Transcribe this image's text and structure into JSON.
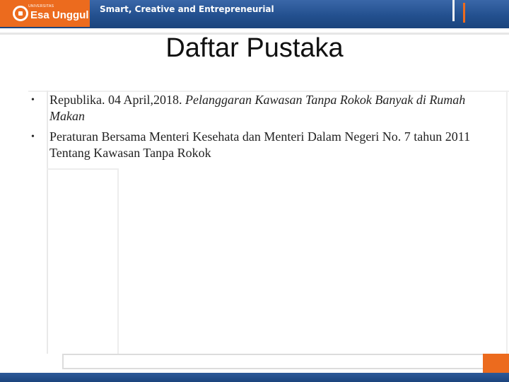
{
  "header": {
    "logo_small": "UNIVERSITAS",
    "logo_text": "Esa Unggul",
    "tagline": "Smart, Creative and Entrepreneurial",
    "colors": {
      "orange": "#ec6b1e",
      "blue": "#23508f"
    }
  },
  "slide": {
    "title": "Daftar Pustaka",
    "bullets": [
      {
        "plain": "Republika. 04 April,2018. ",
        "italic": "Pelanggaran Kawasan Tanpa Rokok Banyak di Rumah Makan"
      },
      {
        "plain": "Peraturan Bersama Menteri Kesehata dan Menteri Dalam Negeri No. 7 tahun 2011 Tentang Kawasan Tanpa Rokok",
        "italic": ""
      }
    ]
  }
}
